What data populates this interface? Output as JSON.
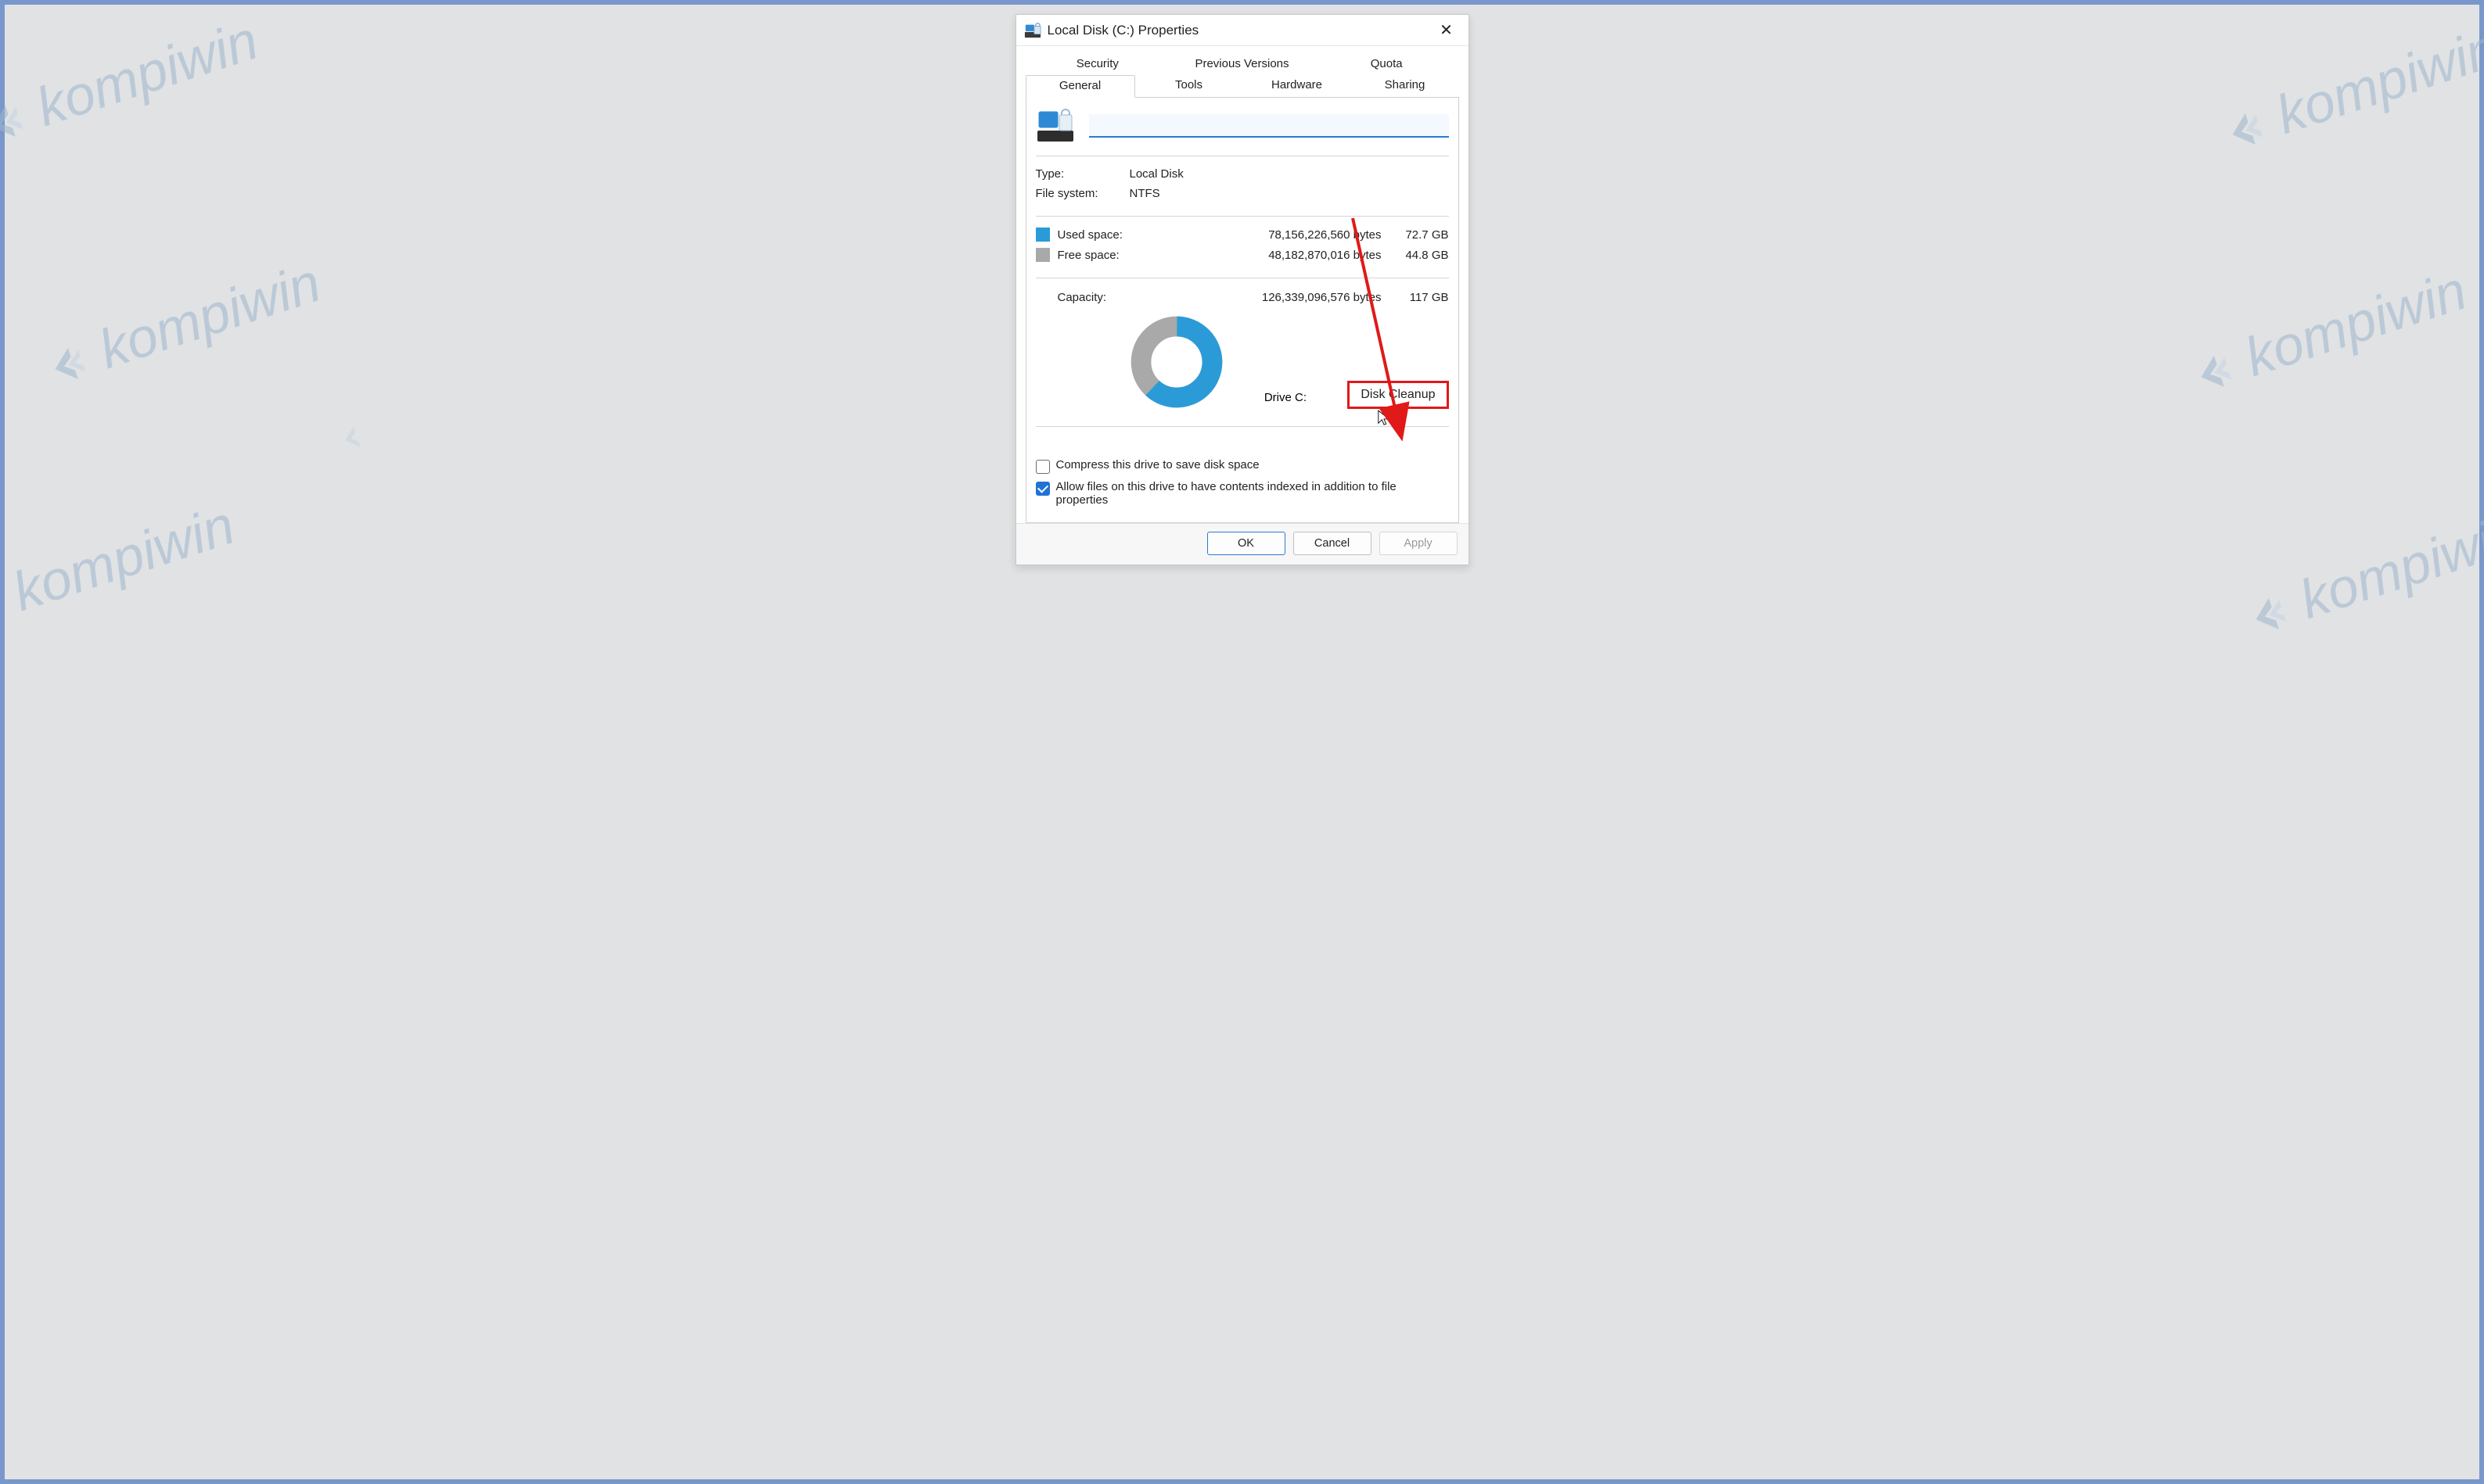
{
  "watermark_text": "kompiwin",
  "window": {
    "title": "Local Disk (C:) Properties"
  },
  "tabs_row1": [
    "Security",
    "Previous Versions",
    "Quota"
  ],
  "tabs_row2": [
    "General",
    "Tools",
    "Hardware",
    "Sharing"
  ],
  "active_tab": "General",
  "drive_name_value": "",
  "info": {
    "type_label": "Type:",
    "type_value": "Local Disk",
    "fs_label": "File system:",
    "fs_value": "NTFS"
  },
  "used": {
    "label": "Used space:",
    "bytes": "78,156,226,560 bytes",
    "gb": "72.7 GB"
  },
  "free": {
    "label": "Free space:",
    "bytes": "48,182,870,016 bytes",
    "gb": "44.8 GB"
  },
  "capacity": {
    "label": "Capacity:",
    "bytes": "126,339,096,576 bytes",
    "gb": "117 GB"
  },
  "drive_label": "Drive C:",
  "cleanup_label": "Disk Cleanup",
  "compress_label": "Compress this drive to save disk space",
  "index_label": "Allow files on this drive to have contents indexed in addition to file properties",
  "buttons": {
    "ok": "OK",
    "cancel": "Cancel",
    "apply": "Apply"
  },
  "chart_data": {
    "type": "pie",
    "title": "Drive C: usage",
    "series": [
      {
        "name": "Used space",
        "value": 78156226560,
        "color": "#2b9bd8"
      },
      {
        "name": "Free space",
        "value": 48182870016,
        "color": "#a9a9a9"
      }
    ]
  }
}
